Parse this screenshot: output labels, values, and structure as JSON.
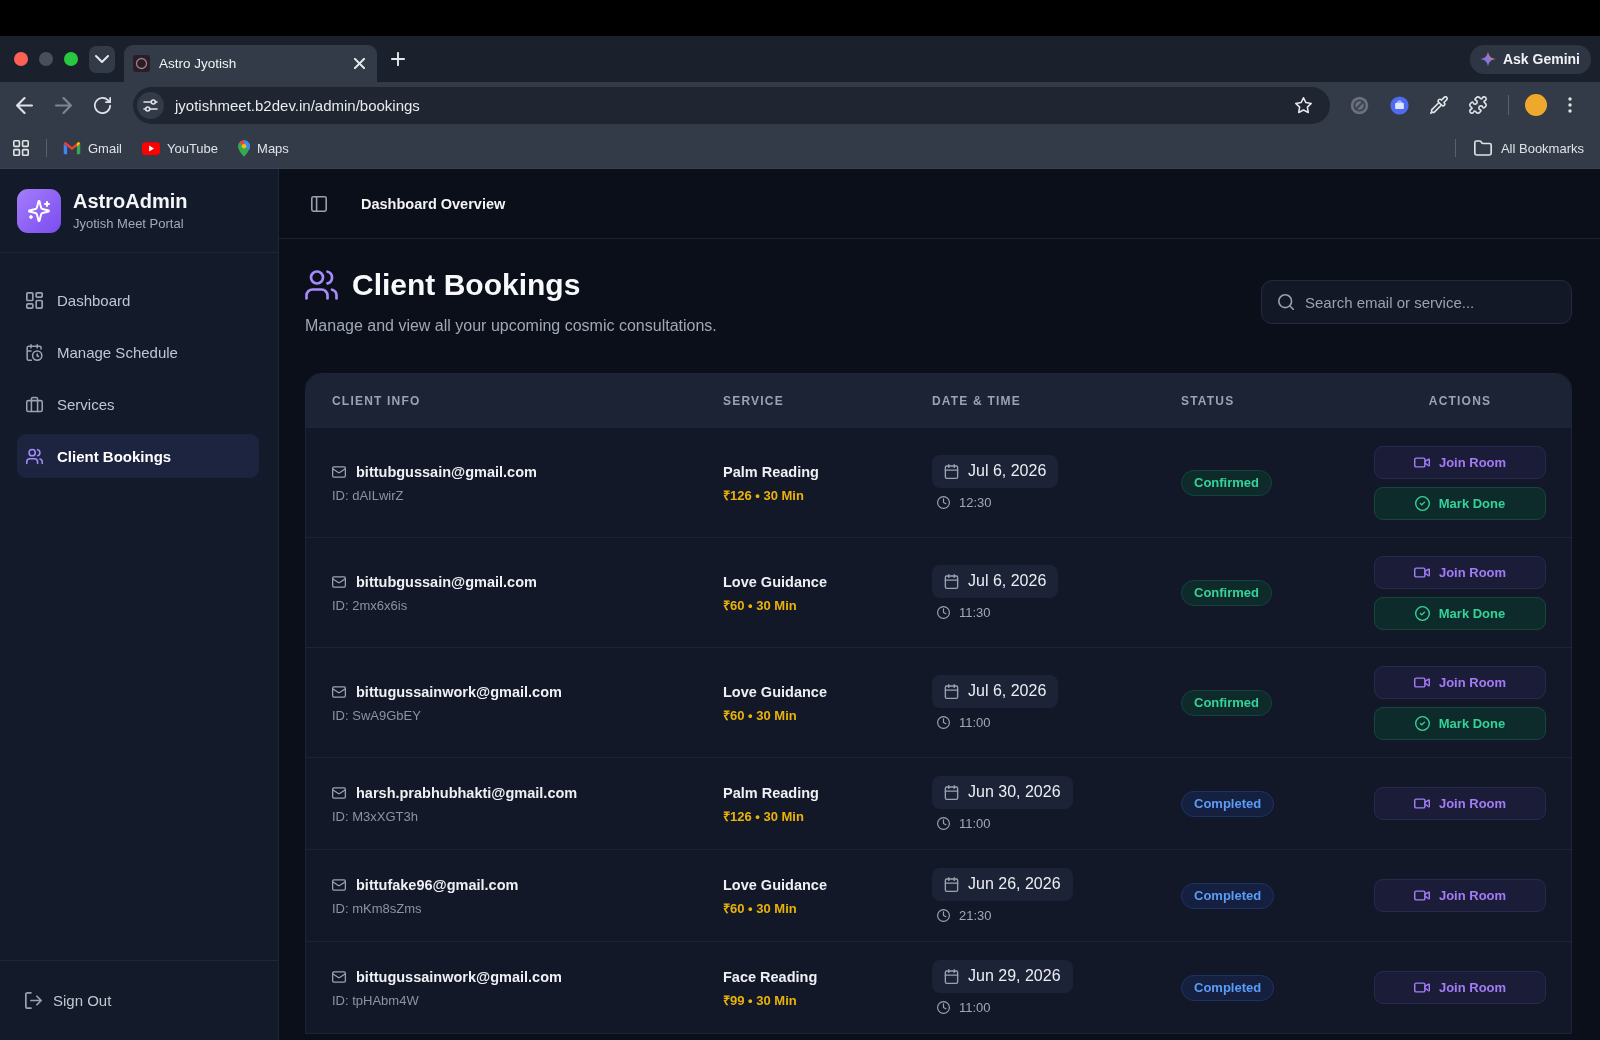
{
  "browser": {
    "tabs": [
      {
        "title": "Astro Jyotish",
        "selected": true
      }
    ],
    "url": "jyotishmeet.b2dev.in/admin/bookings",
    "gemini_button": "Ask Gemini",
    "bookmarks": [
      "Gmail",
      "YouTube",
      "Maps"
    ],
    "all_bookmarks": "All Bookmarks"
  },
  "sidebar": {
    "brand": "AstroAdmin",
    "tagline": "Jyotish Meet Portal",
    "items": [
      {
        "label": "Dashboard",
        "selected": false
      },
      {
        "label": "Manage Schedule",
        "selected": false
      },
      {
        "label": "Services",
        "selected": false
      },
      {
        "label": "Client Bookings",
        "selected": true
      }
    ],
    "sign_out": "Sign Out"
  },
  "topbar": {
    "title": "Dashboard Overview"
  },
  "page": {
    "title": "Client Bookings",
    "subtitle": "Manage and view all your upcoming cosmic consultations.",
    "search": {
      "placeholder": "Search email or service..."
    }
  },
  "table": {
    "columns": [
      "CLIENT INFO",
      "SERVICE",
      "DATE & TIME",
      "STATUS",
      "ACTIONS"
    ],
    "rows": [
      {
        "email": "bittubgussain@gmail.com",
        "id": "ID: dAILwirZ",
        "service": "Palm Reading",
        "price": "₹126 • 30 Min",
        "date": "Jul 6, 2026",
        "time": "12:30",
        "status": {
          "label": "Confirmed",
          "kind": "confirmed"
        },
        "actions": [
          {
            "label": "Join Room",
            "kind": "join"
          },
          {
            "label": "Mark Done",
            "kind": "done"
          }
        ]
      },
      {
        "email": "bittubgussain@gmail.com",
        "id": "ID: 2mx6x6is",
        "service": "Love Guidance",
        "price": "₹60 • 30 Min",
        "date": "Jul 6, 2026",
        "time": "11:30",
        "status": {
          "label": "Confirmed",
          "kind": "confirmed"
        },
        "actions": [
          {
            "label": "Join Room",
            "kind": "join"
          },
          {
            "label": "Mark Done",
            "kind": "done"
          }
        ]
      },
      {
        "email": "bittugussainwork@gmail.com",
        "id": "ID: SwA9GbEY",
        "service": "Love Guidance",
        "price": "₹60 • 30 Min",
        "date": "Jul 6, 2026",
        "time": "11:00",
        "status": {
          "label": "Confirmed",
          "kind": "confirmed"
        },
        "actions": [
          {
            "label": "Join Room",
            "kind": "join"
          },
          {
            "label": "Mark Done",
            "kind": "done"
          }
        ]
      },
      {
        "email": "harsh.prabhubhakti@gmail.com",
        "id": "ID: M3xXGT3h",
        "service": "Palm Reading",
        "price": "₹126 • 30 Min",
        "date": "Jun 30, 2026",
        "time": "11:00",
        "status": {
          "label": "Completed",
          "kind": "completed"
        },
        "actions": [
          {
            "label": "Join Room",
            "kind": "join"
          }
        ]
      },
      {
        "email": "bittufake96@gmail.com",
        "id": "ID: mKm8sZms",
        "service": "Love Guidance",
        "price": "₹60 • 30 Min",
        "date": "Jun 26, 2026",
        "time": "21:30",
        "status": {
          "label": "Completed",
          "kind": "completed"
        },
        "actions": [
          {
            "label": "Join Room",
            "kind": "join"
          }
        ]
      },
      {
        "email": "bittugussainwork@gmail.com",
        "id": "ID: tpHAbm4W",
        "service": "Face Reading",
        "price": "₹99 • 30 Min",
        "date": "Jun 29, 2026",
        "time": "11:00",
        "status": {
          "label": "Completed",
          "kind": "completed"
        },
        "actions": [
          {
            "label": "Join Room",
            "kind": "join"
          }
        ]
      }
    ]
  }
}
